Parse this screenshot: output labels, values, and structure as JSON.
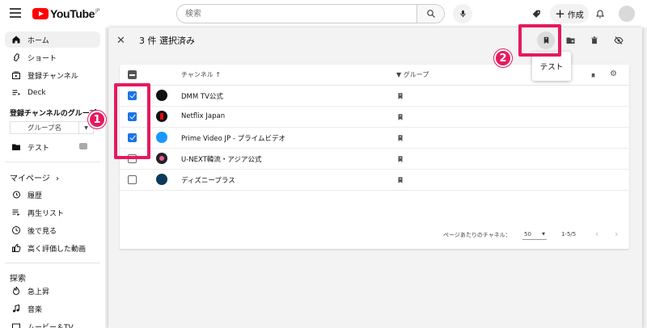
{
  "topbar": {
    "logo_text": "YouTube",
    "logo_region": "JP",
    "search_placeholder": "検索",
    "create_label": "作成"
  },
  "sidebar": {
    "main_items": [
      {
        "label": "ホーム",
        "icon": "home-icon",
        "active": true
      },
      {
        "label": "ショート",
        "icon": "shorts-icon"
      },
      {
        "label": "登録チャンネル",
        "icon": "subscriptions-icon"
      },
      {
        "label": "Deck",
        "icon": "deck-icon"
      }
    ],
    "group_header": "登録チャンネルのグループ",
    "group_dropdown": "グループ名",
    "groups": [
      {
        "label": "テスト",
        "icon": "folder-icon"
      }
    ],
    "mypage_header": "マイページ",
    "mypage_items": [
      {
        "label": "履歴",
        "icon": "history-icon"
      },
      {
        "label": "再生リスト",
        "icon": "playlist-icon"
      },
      {
        "label": "後で見る",
        "icon": "watch-later-icon"
      },
      {
        "label": "高く評価した動画",
        "icon": "like-icon"
      }
    ],
    "explore_header": "探索",
    "explore_items": [
      {
        "label": "急上昇",
        "icon": "trending-icon"
      },
      {
        "label": "音楽",
        "icon": "music-icon"
      },
      {
        "label": "ムービー＆TV",
        "icon": "movie-icon"
      }
    ]
  },
  "panel": {
    "selection_title": "3 件 選択済み",
    "tooltip": "テスト",
    "table": {
      "col_channel": "チャンネル",
      "col_group": "グループ",
      "rows": [
        {
          "name": "DMM TV公式",
          "checked": true,
          "icon_color": "#111111"
        },
        {
          "name": "Netflix Japan",
          "checked": true,
          "icon_color": "#e50914"
        },
        {
          "name": "Prime Video JP - プライムビデオ",
          "checked": true,
          "icon_color": "#1a98ff"
        },
        {
          "name": "U-NEXT韓流・アジア公式",
          "checked": false,
          "icon_color": "#222222"
        },
        {
          "name": "ディズニープラス",
          "checked": false,
          "icon_color": "#0b3a5a"
        }
      ],
      "footer": {
        "per_page_label": "ページあたりのチャネル：",
        "per_page_value": "50",
        "range": "1-5/5"
      }
    }
  },
  "annotations": {
    "badge1": "1",
    "badge2": "2",
    "color": "#e6195e"
  }
}
